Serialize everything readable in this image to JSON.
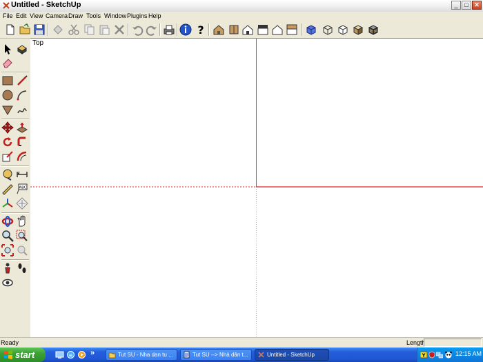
{
  "window": {
    "title": "Untitled - SketchUp",
    "minimize_glyph": "_",
    "maximize_glyph": "□",
    "close_glyph": "✕"
  },
  "menubar": {
    "items": [
      "File",
      "Edit",
      "View",
      "Camera",
      "Draw",
      "Tools",
      "Window",
      "Plugins",
      "Help"
    ]
  },
  "viewport": {
    "view_label": "Top",
    "axis_colors": {
      "green": "#2fa82f",
      "red": "#e02424",
      "blue": "#4a4acc"
    }
  },
  "statusbar": {
    "status": "Ready",
    "length_label": "Length",
    "length_value": ""
  },
  "taskbar": {
    "start_label": "start",
    "overflow_glyph": "»",
    "tasks": [
      {
        "label": "Tut SU - Nha dan tu ...",
        "icon": "folder-icon"
      },
      {
        "label": "Tut SU --> Nhà dân t...",
        "icon": "document-icon"
      },
      {
        "label": "Untitled - SketchUp",
        "icon": "sketchup-icon"
      }
    ],
    "clock": "12:15 AM"
  },
  "toolbar_icons": [
    "new-file-icon",
    "open-folder-icon",
    "save-icon",
    "cut-icon",
    "copy-icon",
    "paste-icon",
    "erase-icon",
    "undo-icon",
    "redo-icon",
    "print-icon",
    "info-icon",
    "help-icon",
    "iso-view-icon",
    "top-view-icon",
    "front-view-icon",
    "right-view-icon",
    "back-view-icon",
    "left-view-icon",
    "xray-icon",
    "wireframe-icon",
    "hidden-line-icon",
    "shaded-icon",
    "textured-icon"
  ]
}
